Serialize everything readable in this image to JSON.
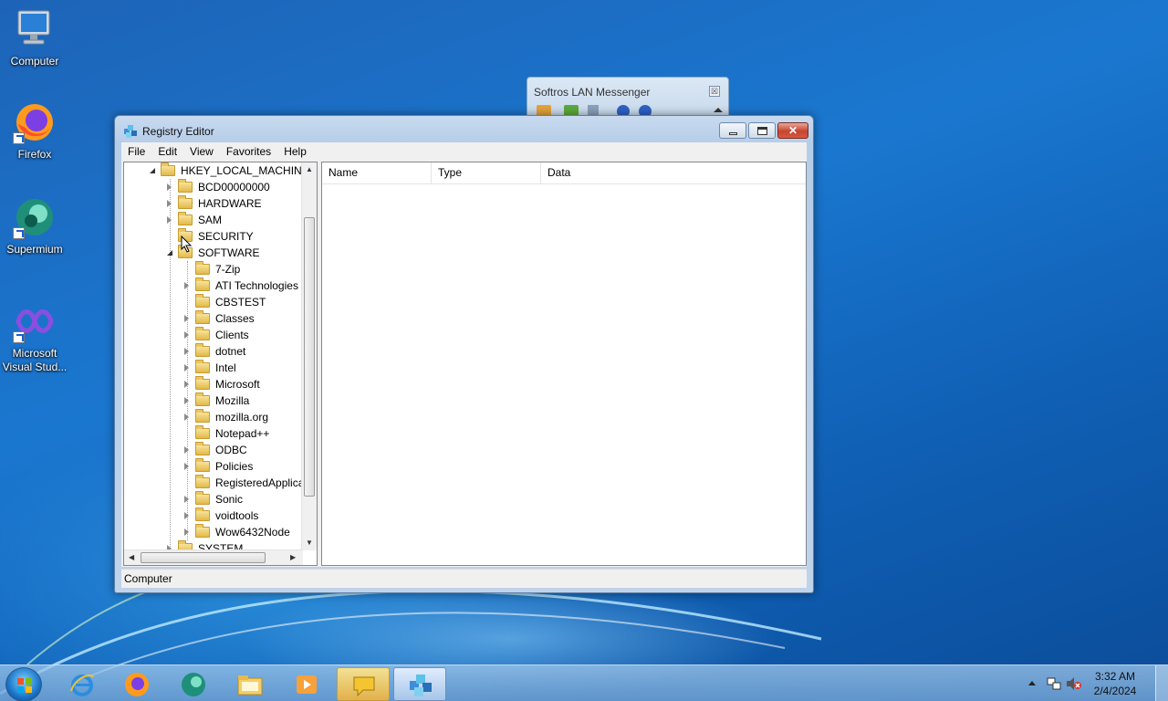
{
  "desktop": {
    "icons": [
      {
        "label": "Computer",
        "icon": "computer-icon"
      },
      {
        "label": "Firefox",
        "icon": "firefox-icon"
      },
      {
        "label": "Supermium",
        "icon": "supermium-icon"
      },
      {
        "label_line1": "Microsoft",
        "label_line2": "Visual Stud...",
        "icon": "visual-studio-icon"
      }
    ]
  },
  "lan_messenger": {
    "title": "Softros LAN Messenger",
    "close_glyph": "☒"
  },
  "registry_editor": {
    "title": "Registry Editor",
    "close_glyph": "✕",
    "menu": [
      "File",
      "Edit",
      "View",
      "Favorites",
      "Help"
    ],
    "tree": {
      "root": "HKEY_LOCAL_MACHINE",
      "hives": [
        "BCD00000000",
        "HARDWARE",
        "SAM",
        "SECURITY",
        "SOFTWARE"
      ],
      "software_children": [
        "7-Zip",
        "ATI Technologies",
        "CBSTEST",
        "Classes",
        "Clients",
        "dotnet",
        "Intel",
        "Microsoft",
        "Mozilla",
        "mozilla.org",
        "Notepad++",
        "ODBC",
        "Policies",
        "RegisteredApplica",
        "Sonic",
        "voidtools",
        "Wow6432Node"
      ],
      "next_hive": "SYSTEM"
    },
    "columns": [
      "Name",
      "Type",
      "Data"
    ],
    "status": "Computer"
  },
  "taskbar": {
    "items": [
      "internet-explorer-icon",
      "firefox-icon",
      "supermium-icon",
      "file-explorer-icon",
      "media-player-icon",
      "lan-messenger-icon",
      "registry-editor-icon"
    ],
    "clock_time": "3:32 AM",
    "clock_date": "2/4/2024"
  }
}
